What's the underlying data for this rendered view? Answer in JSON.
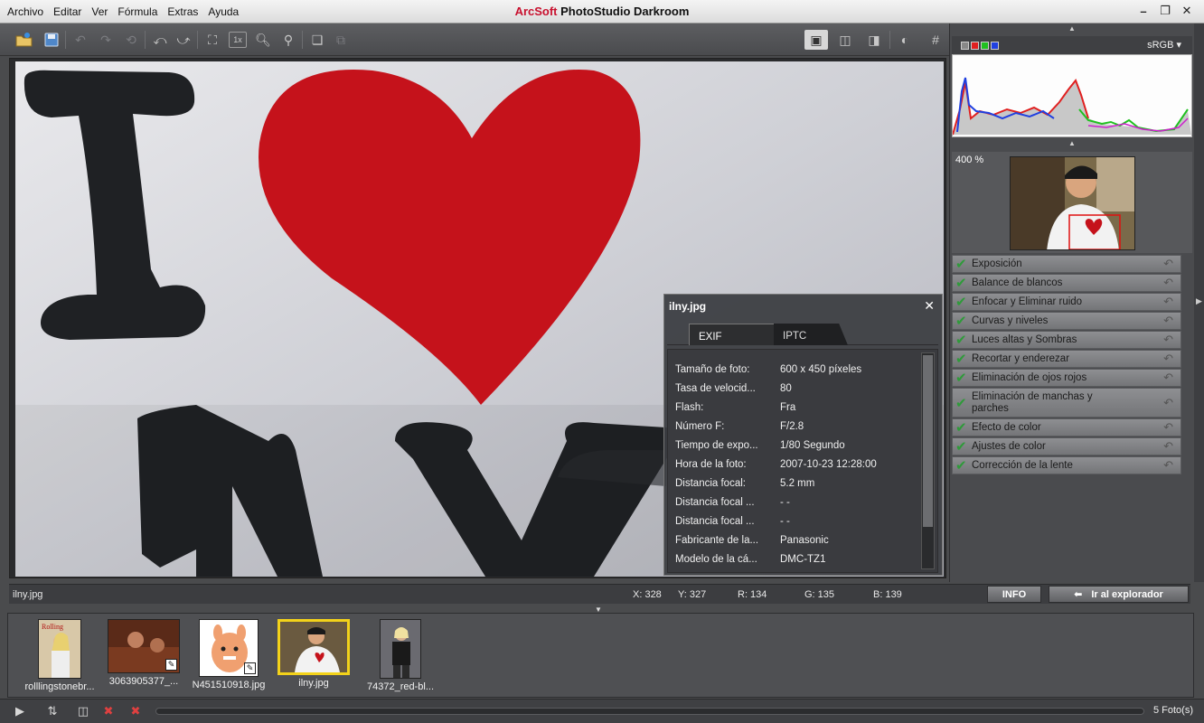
{
  "app": {
    "brand": "ArcSoft",
    "product": "PhotoStudio Darkroom",
    "window_controls": [
      "minimize-icon",
      "restore-icon",
      "close-icon"
    ]
  },
  "menu": [
    "Archivo",
    "Editar",
    "Ver",
    "Fórmula",
    "Extras",
    "Ayuda"
  ],
  "toolbar": {
    "left_icons": [
      "open-folder-icon",
      "save-icon",
      "undo-icon",
      "redo-icon",
      "revert-icon",
      "rotate-left-icon",
      "rotate-right-icon",
      "fit-screen-icon",
      "actual-size-icon",
      "zoom-in-icon",
      "zoom-out-icon",
      "compare-icon",
      "batch-icon"
    ],
    "actual_size_label": "1x",
    "right_icons": [
      "single-view-icon",
      "side-by-side-icon",
      "split-view-icon",
      "globe-icon",
      "grid-icon"
    ]
  },
  "status": {
    "file": "ilny.jpg",
    "x": "X: 328",
    "y": "Y: 327",
    "r": "R: 134",
    "g": "G: 135",
    "b": "B: 139",
    "info_button": "INFO",
    "explorer_button": "Ir al explorador"
  },
  "histogram": {
    "color_space": "sRGB",
    "channels": [
      "rgb",
      "red",
      "green",
      "blue"
    ],
    "channel_colors": [
      "#555555",
      "#e02020",
      "#20c020",
      "#2040e0"
    ]
  },
  "navigator": {
    "zoom": "400 %"
  },
  "adjustments": [
    "Exposición",
    "Balance de blancos",
    "Enfocar y Eliminar ruido",
    "Curvas y niveles",
    "Luces altas y Sombras",
    "Recortar y enderezar",
    "Eliminación de ojos rojos",
    "Eliminación de manchas y parches",
    "Efecto de color",
    "Ajustes de color",
    "Corrección de la lente"
  ],
  "info_panel": {
    "title": "ilny.jpg",
    "tabs": [
      "EXIF",
      "IPTC"
    ],
    "rows": [
      {
        "k": "Tamaño de foto:",
        "v": "600 x 450 píxeles"
      },
      {
        "k": "Tasa de velocid...",
        "v": "80"
      },
      {
        "k": "Flash:",
        "v": "Fra"
      },
      {
        "k": "Número F:",
        "v": "F/2.8"
      },
      {
        "k": "Tiempo de expo...",
        "v": "1/80 Segundo"
      },
      {
        "k": "Hora de la foto:",
        "v": "2007-10-23 12:28:00"
      },
      {
        "k": "Distancia focal:",
        "v": "5.2 mm"
      },
      {
        "k": "Distancia focal ...",
        "v": "- -"
      },
      {
        "k": "Distancia focal ...",
        "v": "- -"
      },
      {
        "k": "Fabricante de la...",
        "v": "Panasonic"
      },
      {
        "k": "Modelo de la cá...",
        "v": "DMC-TZ1"
      }
    ]
  },
  "filmstrip": [
    {
      "caption": "rolllingstonebr...",
      "selected": false,
      "edited": false
    },
    {
      "caption": "3063905377_...",
      "selected": false,
      "edited": true
    },
    {
      "caption": "N451510918.jpg",
      "selected": false,
      "edited": true
    },
    {
      "caption": "ilny.jpg",
      "selected": true,
      "edited": false
    },
    {
      "caption": "74372_red-bl...",
      "selected": false,
      "edited": false
    }
  ],
  "bottom": {
    "count": "5 Foto(s)"
  },
  "colors": {
    "accent_selected": "#f3d21a",
    "check_green": "#2f9a3a",
    "brand_red": "#c8102e"
  }
}
